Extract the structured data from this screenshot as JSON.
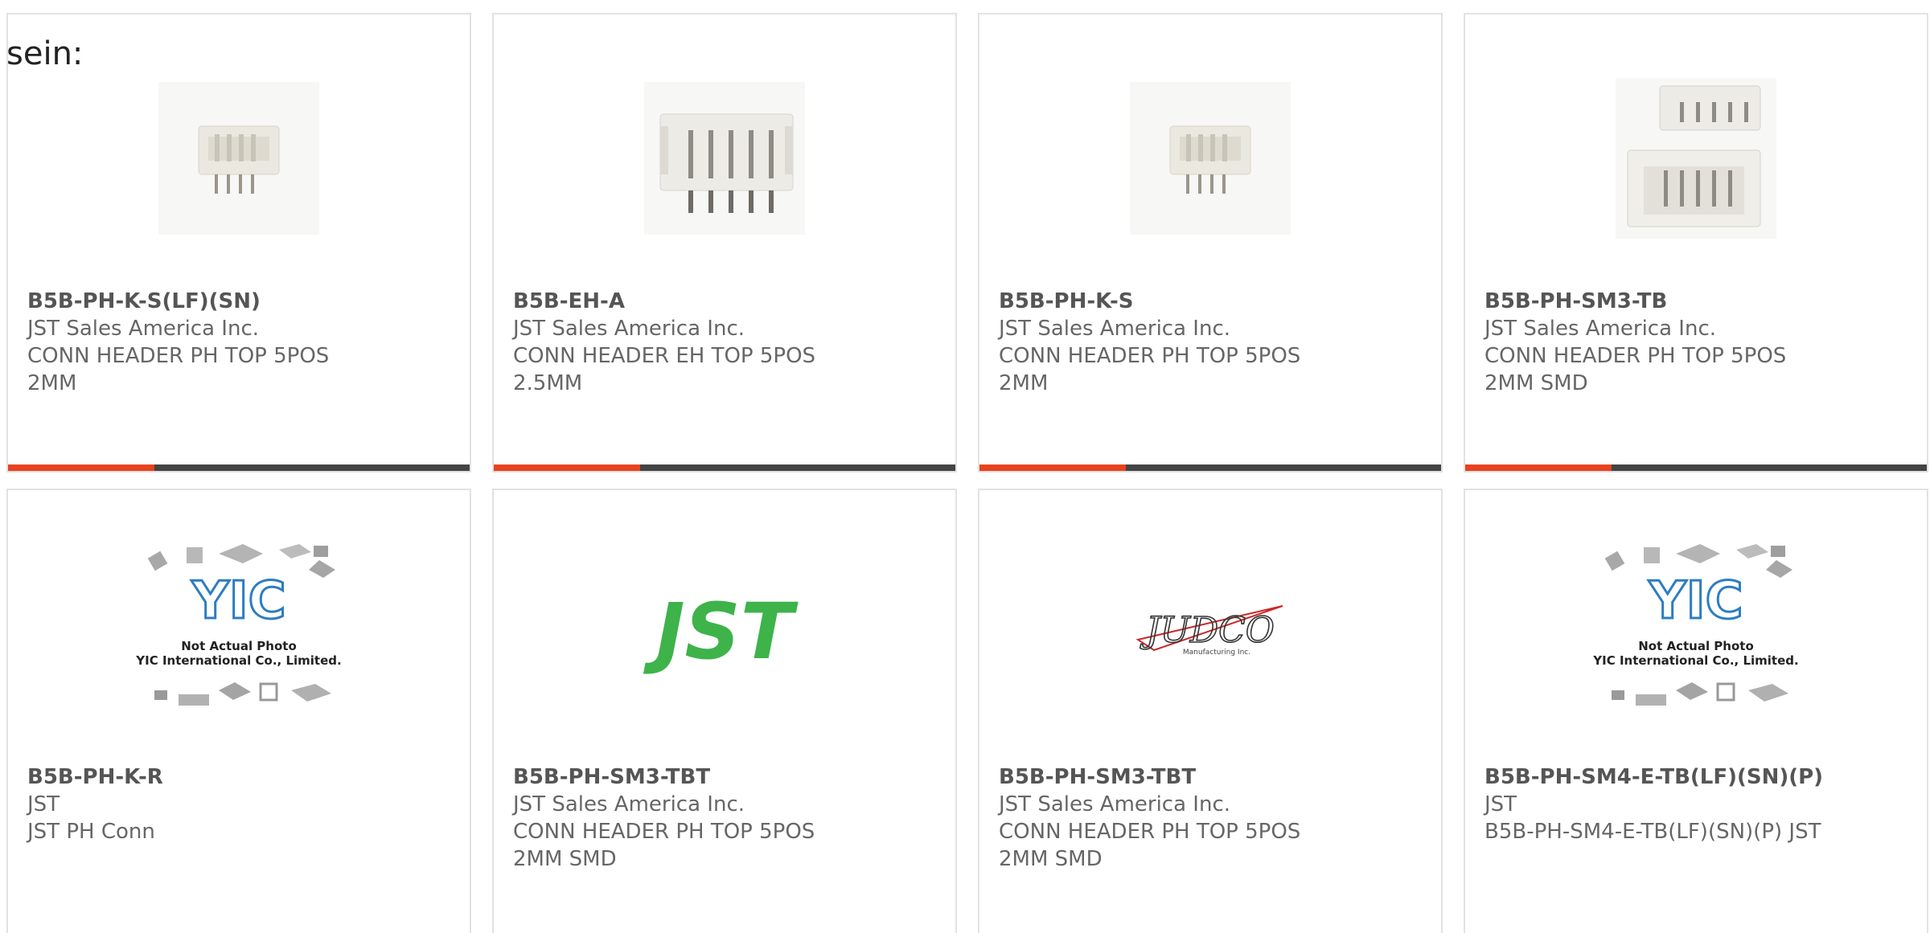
{
  "intro_text": "sein:",
  "accent_color": "#e8431e",
  "products": [
    {
      "part": "B5B-PH-K-S(LF)(SN)",
      "maker": "JST Sales America Inc.",
      "desc": "CONN HEADER PH TOP 5POS 2MM",
      "image": "connector-photo-icon"
    },
    {
      "part": "B5B-EH-A",
      "maker": "JST Sales America Inc.",
      "desc": "CONN HEADER EH TOP 5POS 2.5MM",
      "image": "connector-photo-icon"
    },
    {
      "part": "B5B-PH-K-S",
      "maker": "JST Sales America Inc.",
      "desc": "CONN HEADER PH TOP 5POS 2MM",
      "image": "connector-photo-icon"
    },
    {
      "part": "B5B-PH-SM3-TB",
      "maker": "JST Sales America Inc.",
      "desc": "CONN HEADER PH TOP 5POS 2MM SMD",
      "image": "smd-connector-photo-icon"
    },
    {
      "part": "B5B-PH-K-R",
      "maker": "JST",
      "desc": "JST PH Conn",
      "image": "not-actual-photo-placeholder",
      "placeholder_lines": [
        "Not Actual Photo",
        "YIC International Co., Limited."
      ],
      "placeholder_logo": "YIC"
    },
    {
      "part": "B5B-PH-SM3-TBT",
      "maker": "JST Sales America Inc.",
      "desc": "CONN HEADER PH TOP 5POS 2MM SMD",
      "image": "jst-logo",
      "logo_text": "JST"
    },
    {
      "part": "B5B-PH-SM3-TBT",
      "maker": "JST Sales America Inc.",
      "desc": "CONN HEADER PH TOP 5POS 2MM SMD",
      "image": "judco-logo",
      "logo_text": "JUDCO",
      "logo_sub": "Manufacturing Inc."
    },
    {
      "part": "B5B-PH-SM4-E-TB(LF)(SN)(P)",
      "maker": "JST",
      "desc": "B5B-PH-SM4-E-TB(LF)(SN)(P) JST",
      "image": "not-actual-photo-placeholder",
      "placeholder_lines": [
        "Not Actual Photo",
        "YIC International Co., Limited."
      ],
      "placeholder_logo": "YIC"
    }
  ]
}
